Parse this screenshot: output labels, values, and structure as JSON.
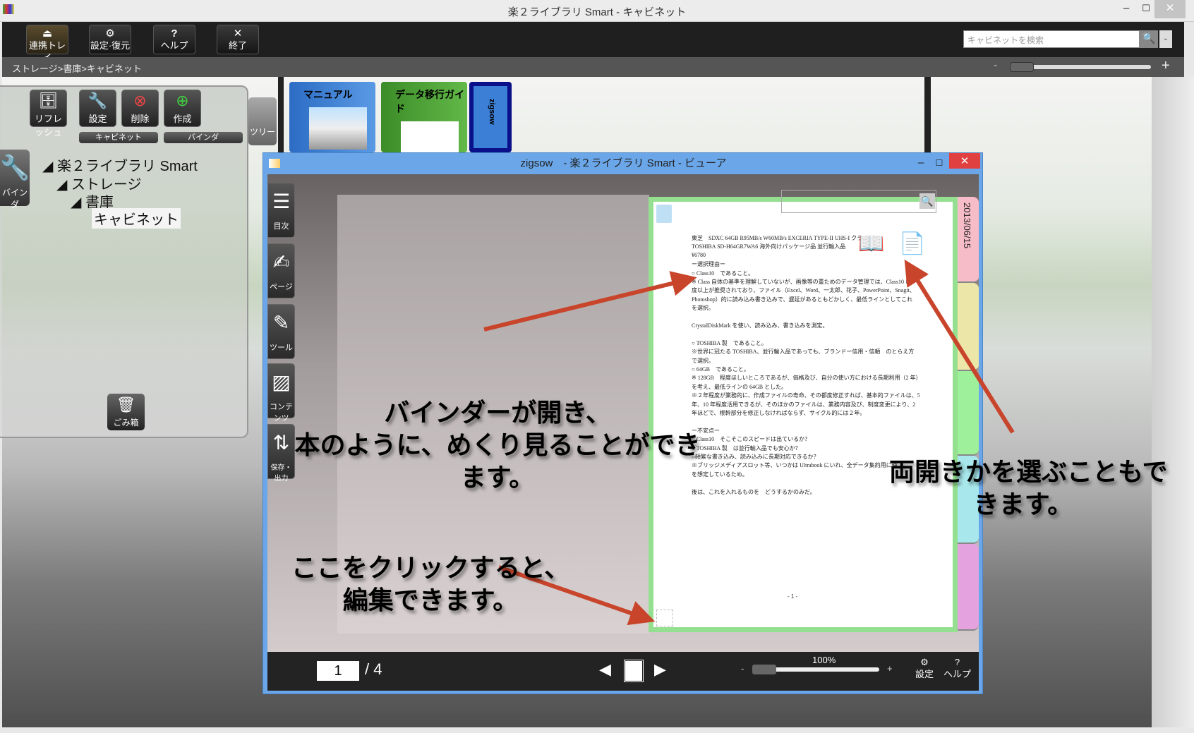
{
  "window": {
    "title": "楽２ライブラリ Smart - キャビネット",
    "minimize": "–",
    "maximize": "☐",
    "close": "✕"
  },
  "toolbar": {
    "buttons": [
      {
        "label": "連携トレイ",
        "icon": "⏏"
      },
      {
        "label": "設定·復元",
        "icon": "⚙"
      },
      {
        "label": "ヘルプ",
        "icon": "?"
      },
      {
        "label": "終了",
        "icon": "✕"
      }
    ],
    "search_placeholder": "キャビネットを検索",
    "search_icon": "🔍",
    "dropdown_icon": "⌄"
  },
  "breadcrumb": "ストレージ>書庫>キャビネット",
  "zoom": {
    "minus": "-",
    "plus": "+",
    "value": 0.05
  },
  "panel": {
    "buttons": [
      {
        "label": "リフレッシュ",
        "icon": "🗄"
      },
      {
        "label": "設定",
        "icon": "🔧"
      },
      {
        "label": "削除",
        "icon": "⊗"
      },
      {
        "label": "作成",
        "icon": "⊕"
      }
    ],
    "groups": [
      "キャビネット",
      "バインダ"
    ],
    "tree_tab": "ツリー",
    "binder_tab": "バインダ",
    "trash": "ごみ箱",
    "tree": [
      "楽２ライブラリ Smart",
      "ストレージ",
      "書庫",
      "キャビネット"
    ]
  },
  "books": [
    {
      "label": "マニュアル",
      "color": "#3c7fd6"
    },
    {
      "label": "データ移行ガイド",
      "color": "#4da034"
    },
    {
      "label": "zigsow",
      "color": "#3c7fd6"
    }
  ],
  "viewer": {
    "title": "zigsow　- 楽２ライブラリ Smart - ビューア",
    "side": [
      {
        "label": "目次",
        "icon": "☰"
      },
      {
        "label": "ページ",
        "icon": "✍"
      },
      {
        "label": "ツール",
        "icon": "✎"
      },
      {
        "label": "コンテンツ",
        "icon": "▨"
      },
      {
        "label": "保存・出力",
        "icon": "⇅"
      }
    ],
    "date_tab": "2013/06/15",
    "tab_colors": [
      "#f6bcc8",
      "#ece7a8",
      "#9ef09a",
      "#a8e8ec",
      "#e4a2de"
    ],
    "doc_lines": [
      "東芝　SDXC 64GB R95MB/s W60MB/s EXCERIA TYPE-II UHS-I クラス１０",
      "TOSHIBA SD-H64GR7WA6 海外向けパッケージ品 並行輸入品",
      "¥6780",
      "ー選択理由ー",
      "○ Class10　であること。",
      "※ Class 自体の基準を理解していないが、画像等の重ためのデータ管理では、Class10 以",
      "度以上が推奨されており、ファイル（Excel、Word、一太郎、花子、PowerPoint、Snagit、",
      "Photoshop）的に読み込み書き込みで、遅延があるともどかしく、最低ラインとしてこれ",
      "を選択。",
      "",
      "CrystalDiskMark を使い、読み込み、書き込みを測定。",
      "",
      "○ TOSHIBA 製　であること。",
      "※世界に冠たる TOSHIBA、並行輸入品であっても、ブランドー信用・信頼　のとらえ方",
      "で選択。",
      "○ 64GB　であること。",
      "※ 128GB　程度ほしいところであるが、価格及び、自分の使い方における長期利用（2 年）",
      "を考え、最低ラインの 64GB とした。",
      "※２年程度が業務的に、作成ファイルの寿命、その都度修正すれば、基本的ファイルは、5",
      "年、10 年程度活用できるが、そのほかのファイルは、業務内容及び、制度変更により、2",
      "年ほどで、根幹部分を修正しなければならず、サイクル的には２年。",
      "",
      "ー不安点ー",
      "○ Class10　そこそこのスピードは出ているか？",
      "○ TOSHIBA 製　は並行輸入品でも安心か？",
      "○頻繁な書き込み、読み込みに長期対応できるか？",
      "※ブリッジメディアスロット等、いつかは Ultrabook にいれ、全データ集約用に使",
      "を想定しているため。",
      "",
      "後は、これを入れるものを　どうするかのみだ。"
    ],
    "page_footer": "- 1 -",
    "page_current": "1",
    "page_total": "/ 4",
    "zoom_label": "100%",
    "zoom_minus": "-",
    "zoom_plus": "+",
    "zoom_value": 0.1,
    "settings": "設定",
    "help": "ヘルプ"
  },
  "annotations": {
    "center": [
      "バインダーが開き、",
      "本のように、めくり見ることができ",
      "ます。"
    ],
    "bottom": [
      "ここをクリックすると、",
      "編集できます。"
    ],
    "right": [
      "両開きかを選ぶこともで",
      "きます。"
    ]
  },
  "accent": "#c8452c"
}
